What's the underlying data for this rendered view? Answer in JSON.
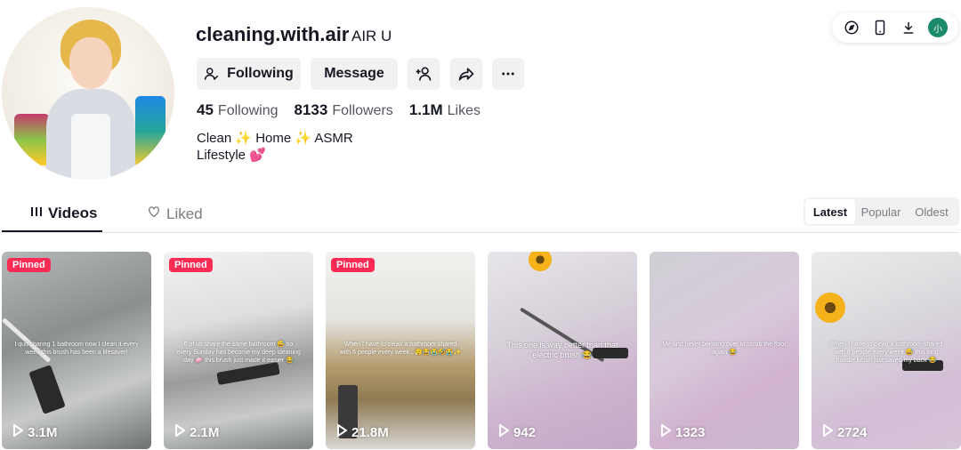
{
  "profile": {
    "username": "cleaning.with.air",
    "nickname": "AIR U",
    "following_button": "Following",
    "message_button": "Message",
    "stats": {
      "following_count": "45",
      "following_label": "Following",
      "followers_count": "8133",
      "followers_label": "Followers",
      "likes_count": "1.1M",
      "likes_label": "Likes"
    },
    "bio_line1": "Clean ✨ Home ✨ ASMR",
    "bio_line2": "Lifestyle 💕"
  },
  "top_icons": {
    "icons": [
      "compass-icon",
      "phone-icon",
      "download-icon"
    ],
    "avatar_letter": "小"
  },
  "tabs": {
    "videos": "Videos",
    "liked": "Liked"
  },
  "sort": {
    "latest": "Latest",
    "popular": "Popular",
    "oldest": "Oldest",
    "selected": "Latest"
  },
  "videos": [
    {
      "pinned": "Pinned",
      "views": "3.1M",
      "caption": "I quit sharing 1 bathroom now I clean it every week this brush has been a lifesaver!"
    },
    {
      "pinned": "Pinned",
      "views": "2.1M",
      "caption": "6 of us share the same bathroom 😅 so every Sunday has become my deep cleaning day 🧼 this brush just made it easier 😂"
    },
    {
      "pinned": "Pinned",
      "views": "21.8M",
      "caption": "When I have to clean a bathroom shared with 6 people every week...😮‍💨😂😭🤣😭✨"
    },
    {
      "pinned": "",
      "views": "942",
      "caption": "This one is way better than that electric brush 😂"
    },
    {
      "pinned": "",
      "views": "1323",
      "caption": "Me and never bending over to scrub the floor again 😂"
    },
    {
      "pinned": "",
      "views": "2724",
      "caption": "When I have to clean a bathroom shared with 6 people every week 😅 this long handle brush just saved my back 😂"
    }
  ],
  "colors": {
    "accent": "#fe2c55",
    "text": "#161823",
    "button_bg": "#f1f1f2"
  }
}
